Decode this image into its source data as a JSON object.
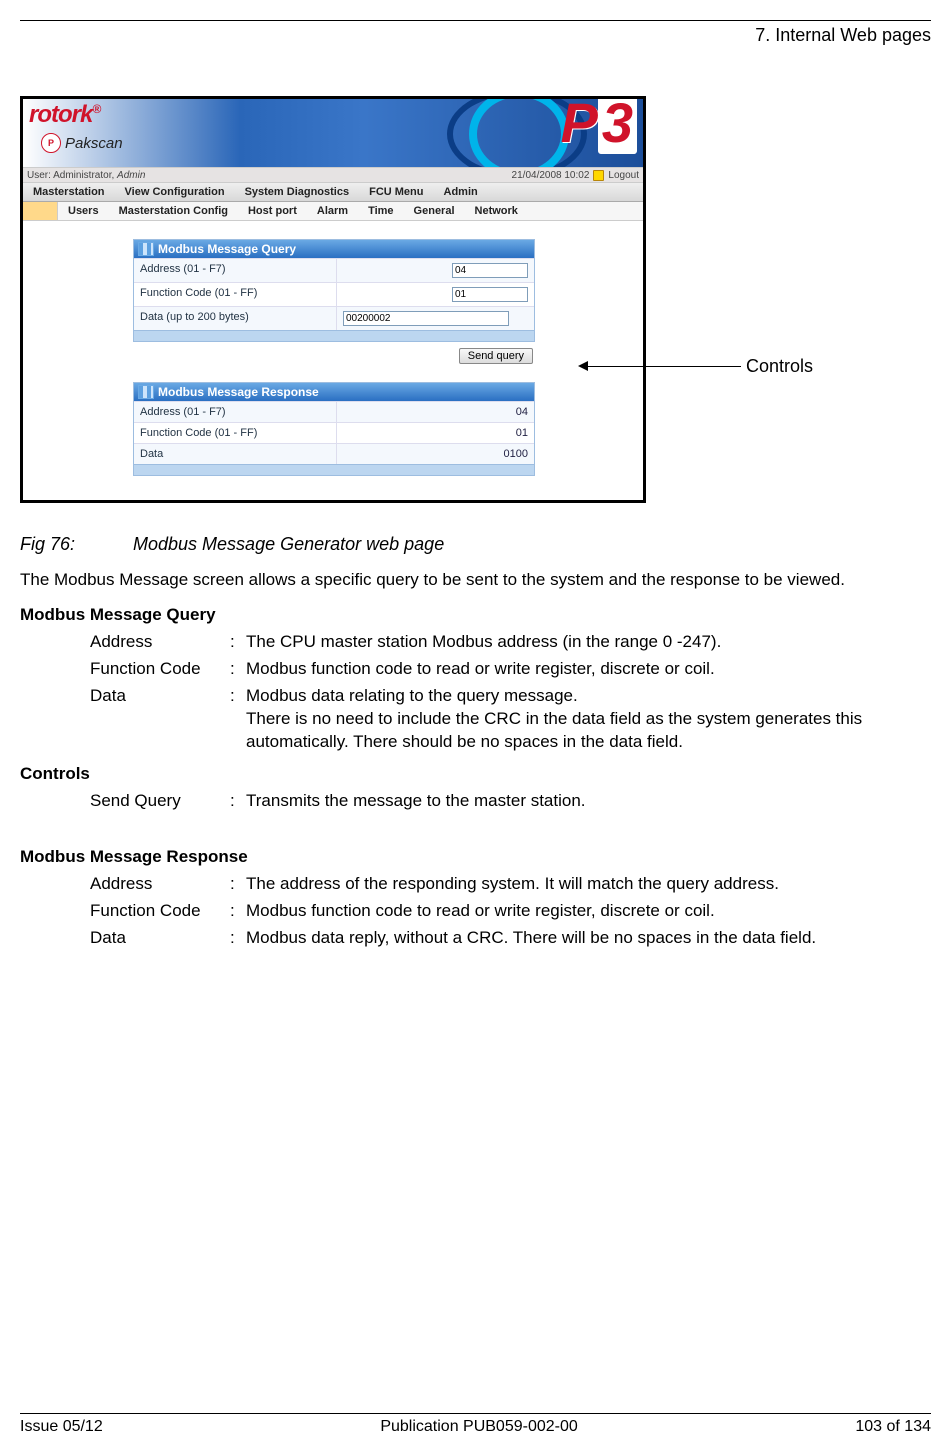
{
  "header": {
    "section_title": "7. Internal Web pages"
  },
  "pointer": {
    "label": "Controls"
  },
  "screenshot": {
    "logo_text": "rotork",
    "logo_super": "®",
    "product_badge": "P",
    "product_name": "Pakscan",
    "p3_label": "P3",
    "userbar": {
      "user_label": "User: Administrator, ",
      "user_role": "Admin",
      "datetime": "21/04/2008 10:02",
      "logout": "Logout"
    },
    "menu": [
      "Masterstation",
      "View Configuration",
      "System Diagnostics",
      "FCU Menu",
      "Admin"
    ],
    "submenu": [
      "Users",
      "Masterstation Config",
      "Host port",
      "Alarm",
      "Time",
      "General",
      "Network"
    ],
    "query_panel": {
      "title": "Modbus Message Query",
      "rows": [
        {
          "label": "Address (01 - F7)",
          "value": "04",
          "wide": false
        },
        {
          "label": "Function Code (01 - FF)",
          "value": "01",
          "wide": false
        },
        {
          "label": "Data (up to 200 bytes)",
          "value": "00200002",
          "wide": true
        }
      ]
    },
    "send_button": "Send query",
    "response_panel": {
      "title": "Modbus Message Response",
      "rows": [
        {
          "label": "Address (01 - F7)",
          "value": "04"
        },
        {
          "label": "Function Code (01 - FF)",
          "value": "01"
        },
        {
          "label": "Data",
          "value": "0100"
        }
      ]
    }
  },
  "caption": {
    "fig": "Fig 76:",
    "text": "Modbus Message Generator web page"
  },
  "intro": "The Modbus Message screen allows a specific query to be sent to the system and the response to be viewed.",
  "query_section": {
    "heading": "Modbus Message Query",
    "items": [
      {
        "term": "Address",
        "desc": "The CPU master station Modbus address (in the range 0 -247)."
      },
      {
        "term": "Function Code",
        "desc": "Modbus function code to read or write register, discrete or coil."
      },
      {
        "term": "Data",
        "desc": "Modbus data relating to the query message.\nThere is no need to include the CRC in the data field as the system generates this automatically. There should be no spaces in the data field."
      }
    ]
  },
  "controls_section": {
    "heading": "Controls",
    "items": [
      {
        "term": "Send Query",
        "desc": "Transmits the message to the master station."
      }
    ]
  },
  "response_section": {
    "heading": "Modbus Message Response",
    "items": [
      {
        "term": "Address",
        "desc": "The address of the responding system. It will match the query address."
      },
      {
        "term": "Function Code",
        "desc": "Modbus function code to read or write register, discrete or coil."
      },
      {
        "term": "Data",
        "desc": "Modbus data reply, without a CRC. There will be no spaces in the data field."
      }
    ]
  },
  "footer": {
    "left": "Issue 05/12",
    "center": "Publication PUB059-002-00",
    "right": "103 of 134"
  }
}
